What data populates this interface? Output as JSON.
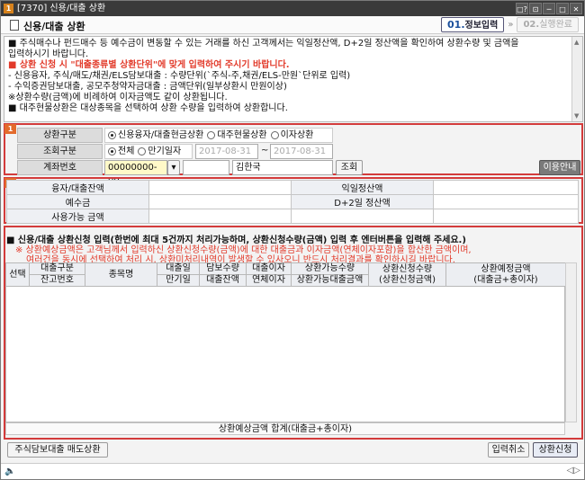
{
  "titlebar": {
    "app_code": "1",
    "title": "[7370] 신용/대출 상환",
    "controls": [
      "□?",
      "⊡",
      "─",
      "□",
      "✕"
    ]
  },
  "header": {
    "title": "신용/대출 상환",
    "steps": [
      {
        "num": "01.",
        "label": "정보입력"
      },
      {
        "num": "02.",
        "label": "실행완료"
      }
    ],
    "arrow": "»"
  },
  "notice": {
    "lines": [
      {
        "text": "■ 주식매수나 펀드매수 등 예수금이 변동할 수 있는 거래를 하신 고객께서는 익일정산액, D+2일 정산액을 확인하여 상환수량 및 금액을",
        "red": false
      },
      {
        "text": "   입력하시기 바랍니다.",
        "red": false
      },
      {
        "text": "■ 상환 신청 시 \"대출종류별 상환단위\"에 맞게 입력하여 주시기 바랍니다.",
        "red": true
      },
      {
        "text": "  - 신용융자, 주식/매도/채권/ELS담보대출 : 수량단위(`주식-주,채권/ELS-만원`단위로 입력)",
        "red": false
      },
      {
        "text": "  - 수익증권담보대출, 공모주청약자금대출 : 금액단위(일부상환시 만원이상)",
        "red": false
      },
      {
        "text": "  ※상환수량(금액)에 비례하여 이자금액도 같이 상환됩니다.",
        "red": false
      },
      {
        "text": "■ 대주현물상환은 대상종목을 선택하여 상환 수량을 입력하여 상환합니다.",
        "red": false
      }
    ],
    "scroll_up": "▲",
    "scroll_down": "▼"
  },
  "section1": {
    "num": "1",
    "repay_type_label": "상환구분",
    "repay_type_options": [
      {
        "label": "신용융자/대출현금상환",
        "selected": true
      },
      {
        "label": "대주현물상환",
        "selected": false
      },
      {
        "label": "이자상환",
        "selected": false
      }
    ],
    "query_type_label": "조회구분",
    "query_type_options": [
      {
        "label": "전체",
        "selected": true
      },
      {
        "label": "만기일자",
        "selected": false
      }
    ],
    "date_from": "2017-08-31",
    "date_to": "2017-08-31",
    "date_sep": "~",
    "account_label": "계좌번호",
    "account_no": "00000000-00",
    "account_name": "김한국",
    "query_button": "조회",
    "guide_button": "이용안내"
  },
  "section2": {
    "num": "2",
    "rows": [
      [
        "융자/대출잔액",
        "",
        "익일정산액",
        ""
      ],
      [
        "예수금",
        "",
        "D+2일 정산액",
        ""
      ],
      [
        "사용가능 금액",
        "",
        "",
        ""
      ]
    ]
  },
  "section3": {
    "title": "■ 신용/대출 상환신청 입력(한번에 최대 5건까지 처리가능하며, 상환신청수량(금액) 입력 후 엔터버튼을 입력해 주세요.)",
    "note1": "※ 상환예상금액은 고객님께서 입력하신 상환신청수량(금액)에 대한 대출금과 이자금액(연체이자포함)을 합산한 금액이며,",
    "note2": "여러건을 동시에 선택하여 처리 시, 상환미처리내역이 발생할 수 있사오니 반드시 처리결과를 확인하시길 바랍니다.",
    "columns": [
      {
        "top": "선택",
        "bottom": ""
      },
      {
        "top": "대출구분",
        "bottom": "잔고번호"
      },
      {
        "top": "종목명",
        "bottom": ""
      },
      {
        "top": "대출일",
        "bottom": "만기일"
      },
      {
        "top": "담보수량",
        "bottom": "대출잔액"
      },
      {
        "top": "대출이자",
        "bottom": "연체이자"
      },
      {
        "top": "상환가능수량",
        "bottom": "상환가능대출금액"
      },
      {
        "top": "상환신청수량",
        "bottom": "(상환신청금액)"
      },
      {
        "top": "상환예정금액",
        "bottom": "(대출금+총이자)"
      }
    ],
    "sum_label": "상환예상금액 합계(대출금+총이자)"
  },
  "footer": {
    "sub_button": "주식담보대출 매도상환",
    "cancel_button": "입력취소",
    "submit_button": "상환신청"
  },
  "statusbar": {
    "icon": "🔈",
    "arrows": "◁▷"
  },
  "colors": {
    "accent_red": "#d33b3b",
    "section_badge": "#e36b2c",
    "step_active": "#1a4f9c"
  }
}
